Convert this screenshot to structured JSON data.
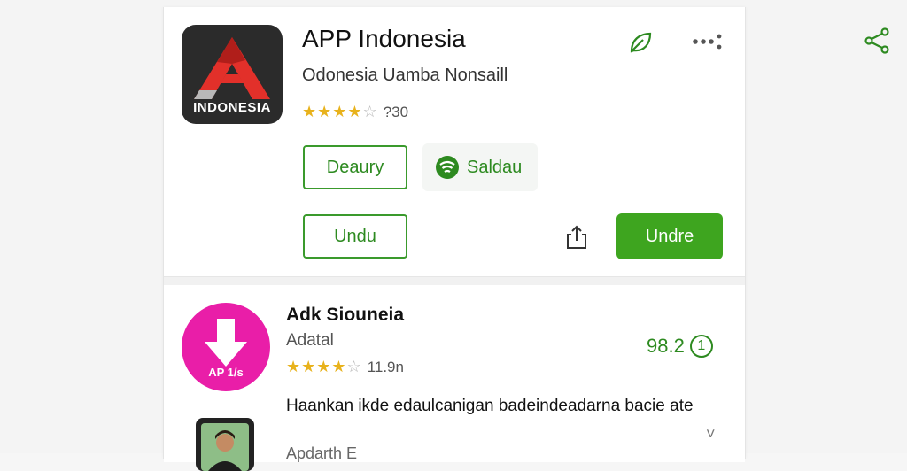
{
  "colors": {
    "accent": "#3ea51f",
    "brand_pink": "#e91ea8",
    "star": "#e8b21c"
  },
  "top_bar": {
    "share_icon": "share-icon"
  },
  "app": {
    "icon_label": "INDONESIA",
    "title": "APP Indonesia",
    "subtitle": "Odonesia Uamba Nonsaill",
    "rating": 4,
    "rating_text": "?30",
    "actions": {
      "leaf_icon": "leaf-icon",
      "more_icon": "more-dots-icon",
      "details_button": "Deaury",
      "chip_label": "Saldau",
      "secondary_button": "Undu",
      "upload_icon": "upload-icon",
      "install_button": "Undre"
    }
  },
  "related": {
    "icon_label": "AP 1/s",
    "title": "Adk Siouneia",
    "subtitle": "Adatal",
    "rating": 4,
    "rating_text": "11.9n",
    "score": "98.2",
    "score_badge": "1",
    "description": "Haankan ikde edaulcanigan badeindeadarna bacie ate",
    "author": "Apdarth E",
    "chevron_icon": "chevron-down-icon"
  }
}
